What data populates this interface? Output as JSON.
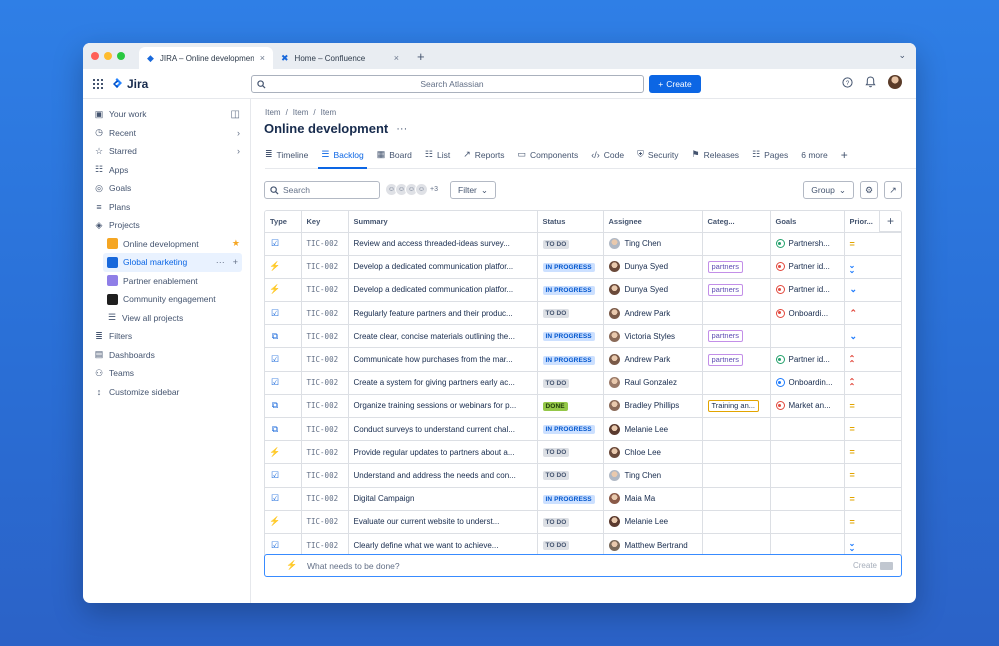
{
  "browser": {
    "tabs": [
      {
        "title": "JIRA – Online development",
        "active": true,
        "icon": "jira-icon"
      },
      {
        "title": "Home – Confluence",
        "active": false,
        "icon": "confluence-icon"
      }
    ],
    "traffic_lights": [
      "#ff5f57",
      "#febc2e",
      "#28c840"
    ]
  },
  "topbar": {
    "product": "Jira",
    "search_placeholder": "Search Atlassian",
    "create_label": "Create",
    "icons": [
      "help-icon",
      "bell-icon",
      "user-avatar"
    ]
  },
  "sidebar": {
    "items": [
      {
        "label": "Your work",
        "icon": "inbox-icon"
      },
      {
        "label": "Recent",
        "icon": "clock-icon",
        "chevron": "›"
      },
      {
        "label": "Starred",
        "icon": "star-icon",
        "chevron": "›"
      },
      {
        "label": "Apps",
        "icon": "apps-icon"
      },
      {
        "label": "Goals",
        "icon": "target-icon"
      },
      {
        "label": "Plans",
        "icon": "plans-icon"
      },
      {
        "label": "Projects",
        "icon": "projects-icon"
      }
    ],
    "projects": [
      {
        "label": "Online development",
        "color": "#f5a623",
        "starred": true
      },
      {
        "label": "Global marketing",
        "color": "#1868db",
        "selected": true
      },
      {
        "label": "Partner enablement",
        "color": "#8f7ee7"
      },
      {
        "label": "Community engagement",
        "color": "#1f1f1f"
      },
      {
        "label": "View all projects"
      }
    ],
    "bottom_items": [
      {
        "label": "Filters",
        "icon": "filter-icon"
      },
      {
        "label": "Dashboards",
        "icon": "dashboard-icon"
      },
      {
        "label": "Teams",
        "icon": "teams-icon"
      },
      {
        "label": "Customize sidebar",
        "icon": "customize-icon"
      }
    ]
  },
  "breadcrumb": [
    "Item",
    "/",
    "Item",
    "/",
    "Item"
  ],
  "page_title": "Online development",
  "tabs": [
    {
      "label": "Timeline",
      "icon": "≣"
    },
    {
      "label": "Backlog",
      "icon": "☰",
      "active": true
    },
    {
      "label": "Board",
      "icon": "▦"
    },
    {
      "label": "List",
      "icon": "☷"
    },
    {
      "label": "Reports",
      "icon": "↗"
    },
    {
      "label": "Components",
      "icon": "▭"
    },
    {
      "label": "Code",
      "icon": "‹/›"
    },
    {
      "label": "Security",
      "icon": "⛨"
    },
    {
      "label": "Releases",
      "icon": "⚑"
    },
    {
      "label": "Pages",
      "icon": "☷"
    },
    {
      "label": "6 more",
      "icon": ""
    }
  ],
  "toolbar": {
    "search_placeholder": "Search",
    "avatar_count": "+3",
    "filter_label": "Filter",
    "group_label": "Group"
  },
  "table": {
    "headers": [
      "Type",
      "Key",
      "Summary",
      "Status",
      "Assignee",
      "Categ...",
      "Goals",
      "Prior..."
    ],
    "rows": [
      {
        "type": "task",
        "key": "TIC-002",
        "summary": "Review and access threaded-ideas survey...",
        "status": "TO DO",
        "assignee": "Ting Chen",
        "avatar": "#b0b8c4",
        "category": "",
        "goal": "Partnersh...",
        "goal_color": "#22a06b",
        "priority": "medium"
      },
      {
        "type": "epic",
        "key": "TIC-002",
        "summary": "Develop a dedicated communication platfor...",
        "status": "IN PROGRESS",
        "assignee": "Dunya Syed",
        "avatar": "#6b4a3a",
        "category": "partners",
        "goal": "Partner id...",
        "goal_color": "#e2483d",
        "priority": "lowest"
      },
      {
        "type": "epic",
        "key": "TIC-002",
        "summary": "Develop a dedicated communication platfor...",
        "status": "IN PROGRESS",
        "assignee": "Dunya Syed",
        "avatar": "#6b4a3a",
        "category": "partners",
        "goal": "Partner id...",
        "goal_color": "#e2483d",
        "priority": "low"
      },
      {
        "type": "task",
        "key": "TIC-002",
        "summary": "Regularly feature partners and their produc...",
        "status": "TO DO",
        "assignee": "Andrew Park",
        "avatar": "#7a5a48",
        "category": "",
        "goal": "Onboardi...",
        "goal_color": "#e2483d",
        "priority": "high"
      },
      {
        "type": "subtask",
        "key": "TIC-002",
        "summary": "Create clear, concise materials outlining the...",
        "status": "IN PROGRESS",
        "assignee": "Victoria Styles",
        "avatar": "#8a6a58",
        "category": "partners",
        "goal": "",
        "goal_color": "",
        "priority": "low"
      },
      {
        "type": "task",
        "key": "TIC-002",
        "summary": "Communicate how purchases from the mar...",
        "status": "IN PROGRESS",
        "assignee": "Andrew Park",
        "avatar": "#7a5a48",
        "category": "partners",
        "goal": "Partner id...",
        "goal_color": "#22a06b",
        "priority": "highest"
      },
      {
        "type": "task",
        "key": "TIC-002",
        "summary": "Create a system for giving partners early ac...",
        "status": "TO DO",
        "assignee": "Raul Gonzalez",
        "avatar": "#9a7a68",
        "category": "",
        "goal": "Onboardin...",
        "goal_color": "#1d7afc",
        "priority": "highest"
      },
      {
        "type": "subtask",
        "key": "TIC-002",
        "summary": "Organize training sessions or webinars for p...",
        "status": "DONE",
        "assignee": "Bradley Phillips",
        "avatar": "#8a6a58",
        "category": "Training an...",
        "goal": "Market an...",
        "goal_color": "#e2483d",
        "priority": "medium"
      },
      {
        "type": "subtask",
        "key": "TIC-002",
        "summary": "Conduct surveys to understand current chal...",
        "status": "IN PROGRESS",
        "assignee": "Melanie Lee",
        "avatar": "#5a3a2e",
        "category": "",
        "goal": "",
        "goal_color": "",
        "priority": "medium"
      },
      {
        "type": "epic",
        "key": "TIC-002",
        "summary": "Provide regular updates to partners about a...",
        "status": "TO DO",
        "assignee": "Chloe Lee",
        "avatar": "#6a4a3a",
        "category": "",
        "goal": "",
        "goal_color": "",
        "priority": "medium"
      },
      {
        "type": "task",
        "key": "TIC-002",
        "summary": "Understand and address the needs and con...",
        "status": "TO DO",
        "assignee": "Ting Chen",
        "avatar": "#b0b8c4",
        "category": "",
        "goal": "",
        "goal_color": "",
        "priority": "medium"
      },
      {
        "type": "task",
        "key": "TIC-002",
        "summary": "Digital Campaign",
        "status": "IN PROGRESS",
        "assignee": "Maia Ma",
        "avatar": "#8a5a48",
        "category": "",
        "goal": "",
        "goal_color": "",
        "priority": "medium"
      },
      {
        "type": "epic",
        "key": "TIC-002",
        "summary": "Evaluate our current website to underst...",
        "status": "TO DO",
        "assignee": "Melanie Lee",
        "avatar": "#5a3a2e",
        "category": "",
        "goal": "",
        "goal_color": "",
        "priority": "medium"
      },
      {
        "type": "task",
        "key": "TIC-002",
        "summary": "Clearly define what we want to achieve...",
        "status": "TO DO",
        "assignee": "Matthew Bertrand",
        "avatar": "#7a6a5a",
        "category": "",
        "goal": "",
        "goal_color": "",
        "priority": "lowest"
      }
    ]
  },
  "new_row": {
    "placeholder": "What needs to be done?",
    "create_label": "Create"
  },
  "colors": {
    "accent": "#0c66e4",
    "todo_bg": "#dcdfe4",
    "inprogress_bg": "#cce0ff",
    "done_bg": "#94c748"
  }
}
